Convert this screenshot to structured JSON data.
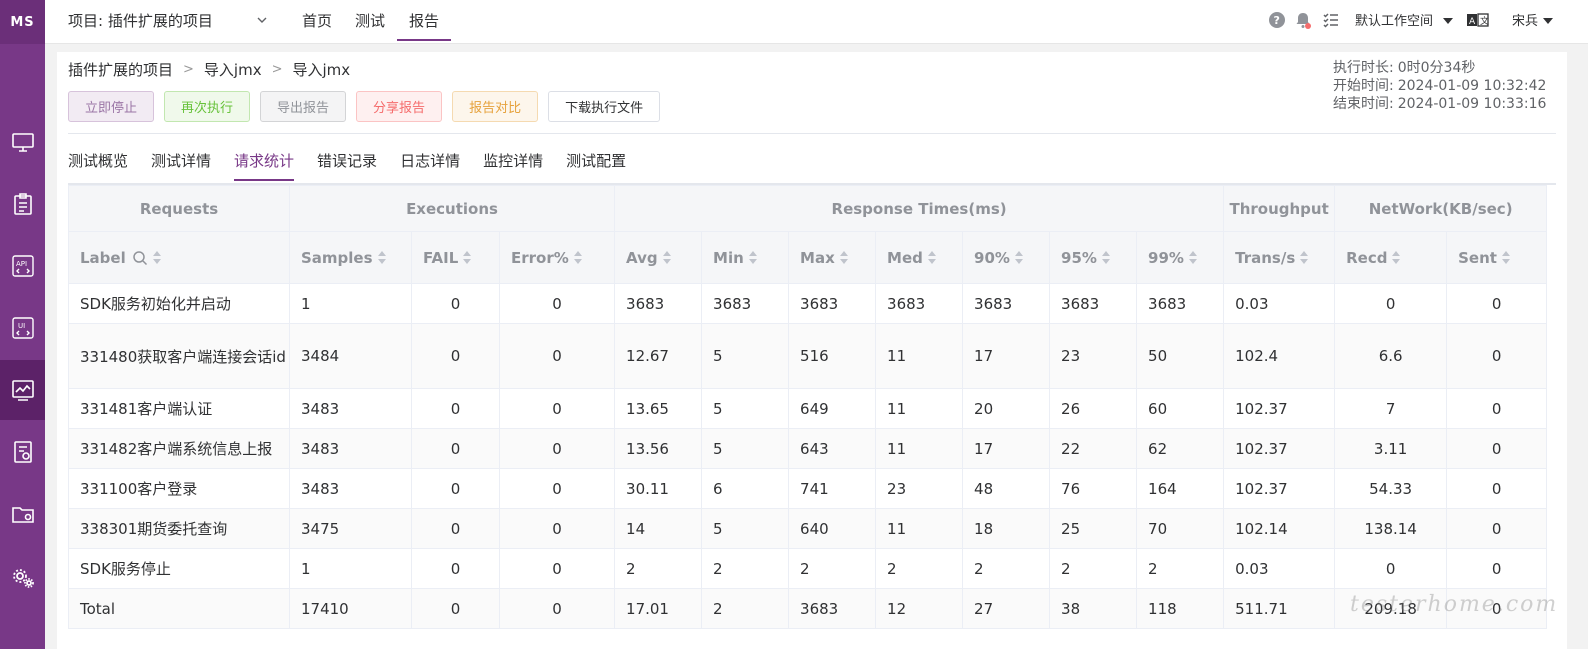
{
  "sidebar": {
    "logo": "MS"
  },
  "header": {
    "project": "项目: 插件扩展的项目",
    "nav": [
      "首页",
      "测试",
      "报告"
    ],
    "workspace": "默认工作空间",
    "user": "宋兵"
  },
  "breadcrumb": [
    "插件扩展的项目",
    "导入jmx",
    "导入jmx"
  ],
  "actions": {
    "stop": "立即停止",
    "rerun": "再次执行",
    "export": "导出报告",
    "share": "分享报告",
    "compare": "报告对比",
    "download": "下载执行文件"
  },
  "timing": {
    "duration_label": "执行时长:",
    "duration": "0时0分34秒",
    "start_label": "开始时间:",
    "start": "2024-01-09 10:32:42",
    "end_label": "结束时间:",
    "end": "2024-01-09 10:33:16"
  },
  "tabs": [
    "测试概览",
    "测试详情",
    "请求统计",
    "错误记录",
    "日志详情",
    "监控详情",
    "测试配置"
  ],
  "table": {
    "groups": [
      "Requests",
      "Executions",
      "Response Times(ms)",
      "Throughput",
      "NetWork(KB/sec)"
    ],
    "columns": [
      "Label",
      "Samples",
      "FAIL",
      "Error%",
      "Avg",
      "Min",
      "Max",
      "Med",
      "90%",
      "95%",
      "99%",
      "Trans/s",
      "Recd",
      "Sent"
    ],
    "rows": [
      [
        "SDK服务初始化并启动",
        "1",
        "0",
        "0",
        "3683",
        "3683",
        "3683",
        "3683",
        "3683",
        "3683",
        "3683",
        "0.03",
        "0",
        "0"
      ],
      [
        "331480获取客户端连接会话id",
        "3484",
        "0",
        "0",
        "12.67",
        "5",
        "516",
        "11",
        "17",
        "23",
        "50",
        "102.4",
        "6.6",
        "0"
      ],
      [
        "331481客户端认证",
        "3483",
        "0",
        "0",
        "13.65",
        "5",
        "649",
        "11",
        "20",
        "26",
        "60",
        "102.37",
        "7",
        "0"
      ],
      [
        "331482客户端系统信息上报",
        "3483",
        "0",
        "0",
        "13.56",
        "5",
        "643",
        "11",
        "17",
        "22",
        "62",
        "102.37",
        "3.11",
        "0"
      ],
      [
        "331100客户登录",
        "3483",
        "0",
        "0",
        "30.11",
        "6",
        "741",
        "23",
        "48",
        "76",
        "164",
        "102.37",
        "54.33",
        "0"
      ],
      [
        "338301期货委托查询",
        "3475",
        "0",
        "0",
        "14",
        "5",
        "640",
        "11",
        "18",
        "25",
        "70",
        "102.14",
        "138.14",
        "0"
      ],
      [
        "SDK服务停止",
        "1",
        "0",
        "0",
        "2",
        "2",
        "2",
        "2",
        "2",
        "2",
        "2",
        "0.03",
        "0",
        "0"
      ],
      [
        "Total",
        "17410",
        "0",
        "0",
        "17.01",
        "2",
        "3683",
        "12",
        "27",
        "38",
        "118",
        "511.71",
        "209.18",
        "0"
      ]
    ]
  },
  "watermark": "testerhome.com"
}
